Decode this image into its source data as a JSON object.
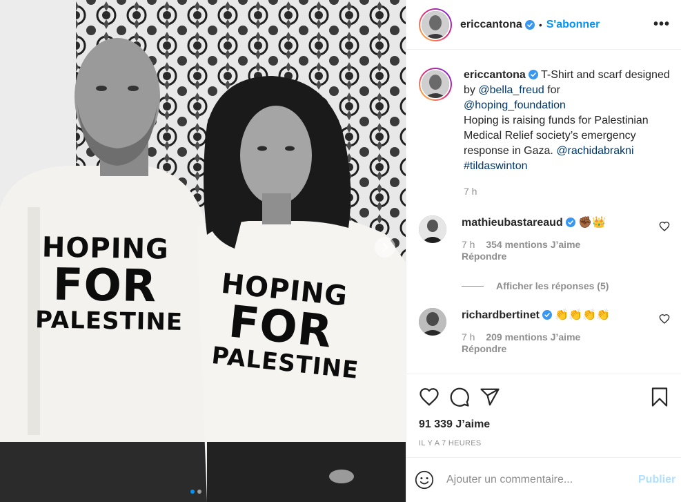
{
  "post": {
    "shirt_left": [
      "HOPING",
      "FOR",
      "PALESTINE"
    ],
    "shirt_right": [
      "HOPING",
      "FOR",
      "PALESTINE"
    ],
    "carousel_index": 1,
    "carousel_count": 2
  },
  "header": {
    "username": "ericcantona",
    "dot": "•",
    "follow_label": "S'abonner",
    "more_label": "•••"
  },
  "caption": {
    "username": "ericcantona",
    "text_1": "T-Shirt and scarf designed by",
    "mention_1": "@bella_freud",
    "text_2": "for",
    "mention_2": "@hoping_foundation",
    "text_3": "Hoping is raising funds for Palestinian Medical Relief society’s emergency response in Gaza.",
    "mention_3": "@rachidabrakni",
    "hashtag": "#tildaswinton",
    "time": "7 h"
  },
  "comments": [
    {
      "username": "mathieubastareaud",
      "text": "✊🏾👑",
      "time": "7 h",
      "likes": "354 mentions J’aime",
      "reply": "Répondre",
      "view_replies": "Afficher les réponses (5)"
    },
    {
      "username": "richardbertinet",
      "text": "👏👏👏👏",
      "time": "7 h",
      "likes": "209 mentions J’aime",
      "reply": "Répondre"
    }
  ],
  "actions": {
    "likes": "91 339 J’aime",
    "posted_ago": "IL Y A 7 HEURES"
  },
  "add_comment": {
    "placeholder": "Ajouter un commentaire...",
    "publish_label": "Publier"
  },
  "colors": {
    "accent": "#0095f6",
    "publish_disabled": "#b2dffc",
    "muted": "#8e8e8e",
    "link": "#00376b"
  }
}
